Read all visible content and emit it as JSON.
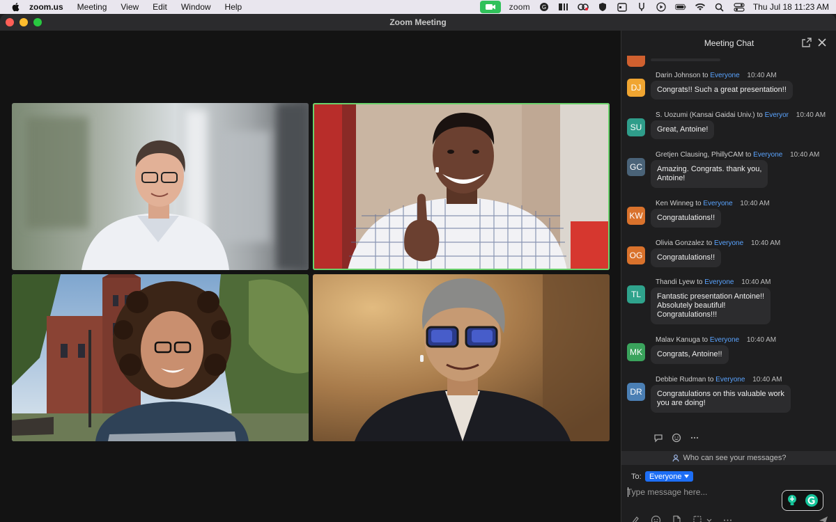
{
  "menubar": {
    "app_name": "zoom.us",
    "menus": [
      "Meeting",
      "View",
      "Edit",
      "Window",
      "Help"
    ],
    "zoom_label": "zoom",
    "clock": "Thu Jul 18  11:23 AM"
  },
  "window": {
    "title": "Zoom Meeting"
  },
  "chat": {
    "title": "Meeting Chat",
    "messages": [
      {
        "initials": "DJ",
        "sender": "Darin Johnson",
        "to": "to",
        "recipient": "Everyone",
        "time": "10:40 AM",
        "text": "Congrats!! Such a great presentation!!",
        "color": "#f0a531"
      },
      {
        "initials": "SU",
        "sender": "S. Uozumi (Kansai Gaidai Univ.)",
        "to": "to",
        "recipient": "Everyor",
        "time": "10:40 AM",
        "text": "Great, Antoine!",
        "color": "#2f9d8a"
      },
      {
        "initials": "GC",
        "sender": "Gretjen Clausing, PhillyCAM",
        "to": "to",
        "recipient": "Everyone",
        "time": "10:40 AM",
        "text_lines": [
          "Amazing.  Congrats.  thank you,",
          "Antoine!"
        ],
        "color": "#4a6378"
      },
      {
        "initials": "KW",
        "sender": "Ken Winneg",
        "to": "to",
        "recipient": "Everyone",
        "time": "10:40 AM",
        "text": "Congratulations!!",
        "color": "#d9722c"
      },
      {
        "initials": "OG",
        "sender": "Olivia Gonzalez",
        "to": "to",
        "recipient": "Everyone",
        "time": "10:40 AM",
        "text": "Congratulations!!",
        "color": "#d9722c"
      },
      {
        "initials": "TL",
        "sender": "Thandi Lyew",
        "to": "to",
        "recipient": "Everyone",
        "time": "10:40 AM",
        "text_lines": [
          "Fantastic presentation Antoine!!",
          "Absolutely beautiful!",
          "Congratulations!!!"
        ],
        "color": "#2fa38c"
      },
      {
        "initials": "MK",
        "sender": "Malav Kanuga",
        "to": "to",
        "recipient": "Everyone",
        "time": "10:40 AM",
        "text": "Congrats, Antoine!!",
        "color": "#3aa35c"
      },
      {
        "initials": "DR",
        "sender": "Debbie Rudman",
        "to": "to",
        "recipient": "Everyone",
        "time": "10:40 AM",
        "text_lines": [
          "Congratulations on this valuable work",
          "you are doing!"
        ],
        "color": "#4b7fb4"
      }
    ],
    "who_can_see": "Who can see your messages?",
    "compose": {
      "to_label": "To:",
      "recipient": "Everyone",
      "placeholder": "Type message here..."
    }
  },
  "colors": {
    "active_speaker_border": "#6bd26b",
    "link_blue": "#5aa4ff",
    "recipient_chip": "#1d6ef5"
  }
}
